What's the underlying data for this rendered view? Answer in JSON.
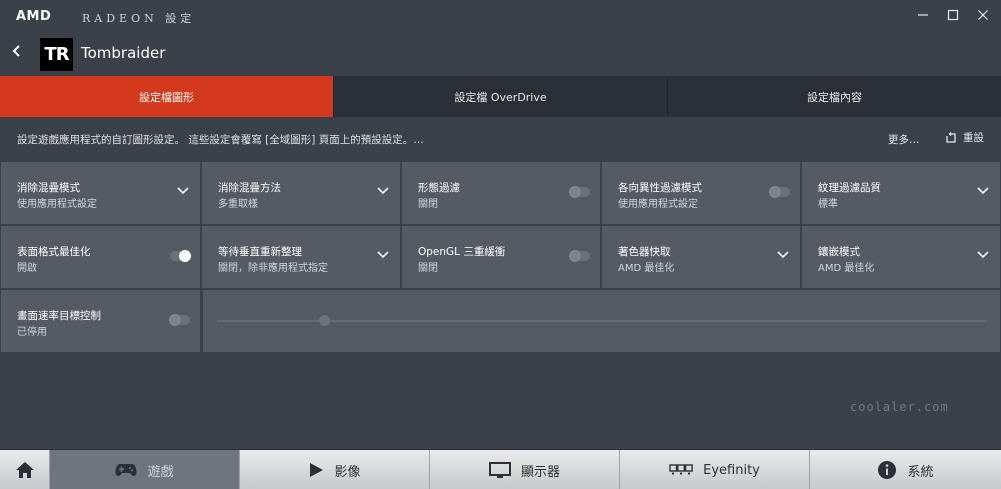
{
  "titlebar": {
    "brand": "AMD",
    "app_name": "RADEON 設定",
    "minimize": "—",
    "maximize": "☐",
    "close": "✕"
  },
  "header": {
    "back_icon": "chevron-left-icon",
    "game_logo_text": "TR",
    "game_title": "Tombraider"
  },
  "tabs": [
    {
      "label": "設定檔圖形",
      "active": true
    },
    {
      "label": "設定檔 OverDrive",
      "active": false
    },
    {
      "label": "設定檔內容",
      "active": false
    }
  ],
  "description": {
    "text": "設定遊戲應用程式的自訂圖形設定。 這些設定會覆寫 [全域圖形] 頁面上的預設設定。…",
    "more_label": "更多…",
    "reset_label": "重設"
  },
  "settings": {
    "row1": [
      {
        "label": "消除混疊模式",
        "value": "使用應用程式設定",
        "control": "dropdown"
      },
      {
        "label": "消除混疊方法",
        "value": "多重取樣",
        "control": "dropdown"
      },
      {
        "label": "形態過濾",
        "value": "關閉",
        "control": "toggle",
        "on": false
      },
      {
        "label": "各向異性過濾模式",
        "value": "使用應用程式設定",
        "control": "toggle",
        "on": false
      },
      {
        "label": "紋理過濾品質",
        "value": "標準",
        "control": "dropdown"
      }
    ],
    "row2": [
      {
        "label": "表面格式最佳化",
        "value": "開啟",
        "control": "toggle",
        "on": true
      },
      {
        "label": "等待垂直重新整理",
        "value": "關閉，除非應用程式指定",
        "control": "dropdown"
      },
      {
        "label": "OpenGL 三重緩衝",
        "value": "關閉",
        "control": "toggle",
        "on": false
      },
      {
        "label": "著色器快取",
        "value": "AMD 最佳化",
        "control": "dropdown"
      },
      {
        "label": "鑲嵌模式",
        "value": "AMD 最佳化",
        "control": "dropdown"
      }
    ],
    "row3": [
      {
        "label": "畫面速率目標控制",
        "value": "已停用",
        "control": "toggle",
        "on": false
      }
    ],
    "frame_rate_slider": {
      "level": 0.14,
      "enabled": false
    }
  },
  "bottom_nav": [
    {
      "label": "",
      "icon": "home-icon",
      "active": false
    },
    {
      "label": "遊戲",
      "icon": "gamepad-icon",
      "active": true
    },
    {
      "label": "影像",
      "icon": "play-icon",
      "active": false
    },
    {
      "label": "顯示器",
      "icon": "monitor-icon",
      "active": false
    },
    {
      "label": "Eyefinity",
      "icon": "eyefinity-icon",
      "active": false
    },
    {
      "label": "系統",
      "icon": "info-icon",
      "active": false
    }
  ],
  "watermark": "coolaler.com"
}
